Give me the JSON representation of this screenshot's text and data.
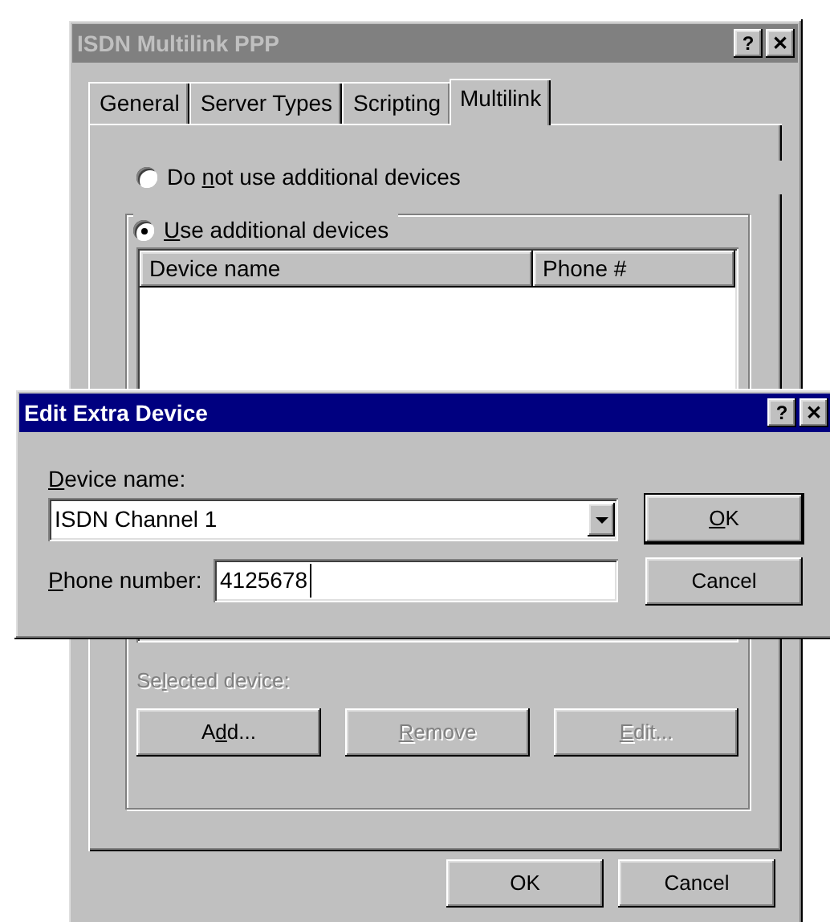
{
  "main_window": {
    "title": "ISDN Multilink PPP",
    "active": false,
    "title_buttons": [
      "?",
      "✕"
    ],
    "tabs": [
      {
        "label": "General",
        "selected": false
      },
      {
        "label": "Server Types",
        "selected": false
      },
      {
        "label": "Scripting",
        "selected": false
      },
      {
        "label": "Multilink",
        "selected": true
      }
    ],
    "radios": [
      {
        "pre": "Do ",
        "key": "n",
        "post": "ot use additional devices",
        "selected": false
      },
      {
        "key": "U",
        "post": "se additional devices",
        "selected": true
      }
    ],
    "list": {
      "columns": [
        "Device name",
        "Phone #"
      ]
    },
    "selected_device_label": {
      "pre": "Se",
      "key": "l",
      "post": "ected device:",
      "disabled": true
    },
    "group_buttons": [
      {
        "pre": "A",
        "key": "d",
        "post": "d...",
        "disabled": false
      },
      {
        "key": "R",
        "post": "emove",
        "disabled": true
      },
      {
        "key": "E",
        "post": "dit...",
        "disabled": true
      }
    ],
    "buttons": [
      {
        "post": "OK"
      },
      {
        "post": "Cancel"
      }
    ]
  },
  "dialog": {
    "title": "Edit Extra Device",
    "active": true,
    "title_buttons": [
      "?",
      "✕"
    ],
    "device_label": {
      "key": "D",
      "post": "evice name:"
    },
    "device_value": "ISDN Channel 1",
    "phone_label": {
      "key": "P",
      "post": "hone number:"
    },
    "phone_value": "4125678",
    "buttons": [
      {
        "key": "O",
        "post": "K",
        "default": true
      },
      {
        "post": "Cancel",
        "default": false
      }
    ]
  }
}
